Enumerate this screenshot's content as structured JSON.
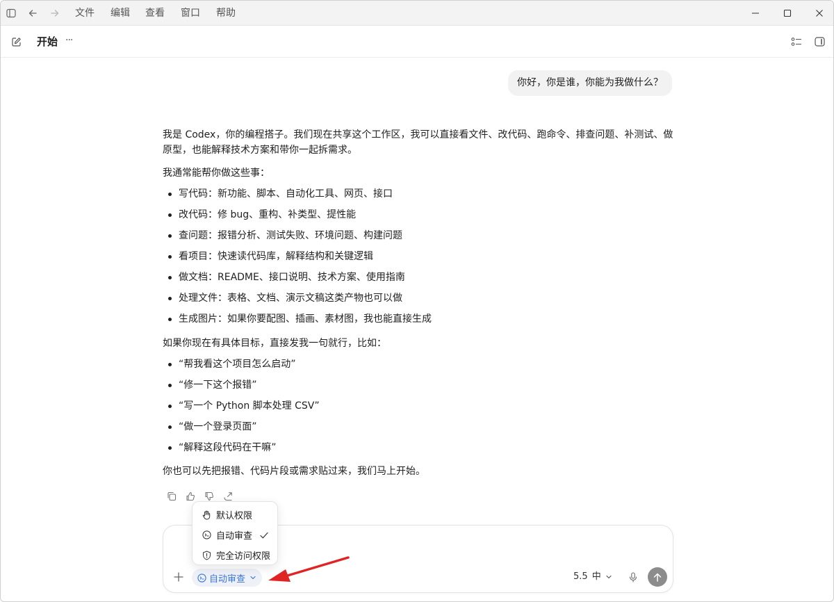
{
  "menu": {
    "file": "文件",
    "edit": "编辑",
    "view": "查看",
    "window": "窗口",
    "help": "帮助"
  },
  "toolbar": {
    "title": "开始",
    "more": "···"
  },
  "conversation": {
    "user_message": "你好，你是谁，你能为我做什么？",
    "reply_intro": "我是 Codex，你的编程搭子。我们现在共享这个工作区，我可以直接看文件、改代码、跑命令、排查问题、补测试、做原型，也能解释技术方案和带你一起拆需求。",
    "reply_list_heading": "我通常能帮你做这些事：",
    "capabilities": [
      "写代码：新功能、脚本、自动化工具、网页、接口",
      "改代码：修 bug、重构、补类型、提性能",
      "查问题：报错分析、测试失败、环境问题、构建问题",
      "看项目：快速读代码库，解释结构和关键逻辑",
      "做文档：README、接口说明、技术方案、使用指南",
      "处理文件：表格、文档、演示文稿这类产物也可以做",
      "生成图片：如果你要配图、插画、素材图，我也能直接生成"
    ],
    "examples_heading": "如果你现在有具体目标，直接发我一句就行，比如：",
    "examples": [
      "“帮我看这个项目怎么启动”",
      "“修一下这个报错”",
      "“写一个 Python 脚本处理 CSV”",
      "“做一个登录页面”",
      "“解释这段代码在干嘛”"
    ],
    "closing": "你也可以先把报错、代码片段或需求贴过来，我们马上开始。"
  },
  "permissions_menu": {
    "items": [
      {
        "label": "默认权限",
        "icon": "hand-icon"
      },
      {
        "label": "自动审查",
        "icon": "auto-review-icon",
        "selected": true
      },
      {
        "label": "完全访问权限",
        "icon": "alert-shield-icon"
      }
    ]
  },
  "composer": {
    "permission_label": "自动审查",
    "model_version": "5.5",
    "reasoning_level": "中"
  },
  "colors": {
    "accent": "#3b74d8",
    "annotation_arrow": "#e02424",
    "send_button": "#8c8c8c"
  }
}
